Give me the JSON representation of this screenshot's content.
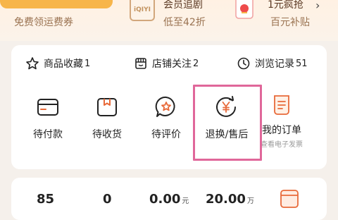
{
  "promo": {
    "items": [
      {
        "title": "",
        "subtitle": "免费领运费券"
      },
      {
        "title": "会员追剧",
        "subtitle": "低至42折",
        "logo_text": "iQIYI"
      },
      {
        "title": "1元疯抢",
        "subtitle": "百元补贴"
      }
    ]
  },
  "stats": [
    {
      "label": "商品收藏",
      "count": "1",
      "icon": "star-icon"
    },
    {
      "label": "店铺关注",
      "count": "2",
      "icon": "store-icon"
    },
    {
      "label": "浏览记录",
      "count": "51",
      "icon": "clock-icon"
    }
  ],
  "orders": [
    {
      "label": "待付款",
      "icon": "wallet-card-icon"
    },
    {
      "label": "待收货",
      "icon": "package-icon"
    },
    {
      "label": "待评价",
      "icon": "review-star-bubble-icon"
    },
    {
      "label": "退换/售后",
      "icon": "yen-refresh-icon"
    },
    {
      "label": "我的订单",
      "sub": "查看电子发票",
      "icon": "order-list-icon"
    }
  ],
  "assets": [
    {
      "value": "85",
      "unit": ""
    },
    {
      "value": "0",
      "unit": ""
    },
    {
      "value": "0.00",
      "unit": "元"
    },
    {
      "value": "20.00",
      "unit": "万"
    }
  ],
  "colors": {
    "highlight": "#e0679a",
    "orange_accent": "#f7b54a",
    "order_icon_accent": "#e86a3a"
  }
}
